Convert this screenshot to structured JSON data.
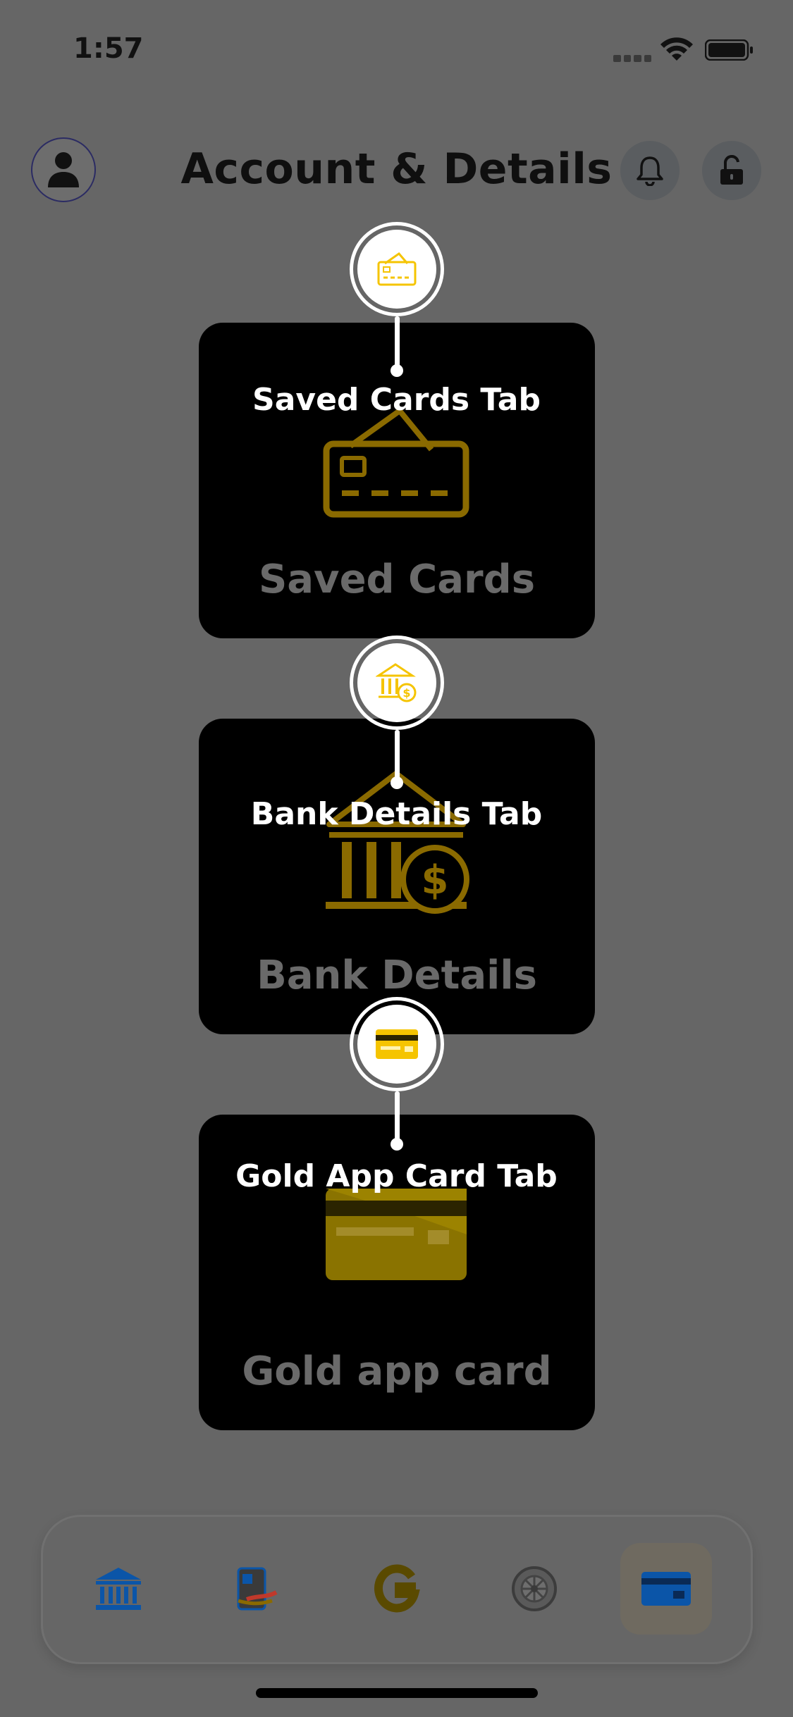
{
  "status_bar": {
    "time": "1:57"
  },
  "header": {
    "title": "Account & Details",
    "icons": [
      "user-icon",
      "bell-icon",
      "unlock-icon"
    ]
  },
  "cards": [
    {
      "label": "Saved Cards",
      "icon": "credit-card-icon"
    },
    {
      "label": "Bank Details",
      "icon": "bank-dollar-icon"
    },
    {
      "label": "Gold app card",
      "icon": "gold-card-icon"
    }
  ],
  "coachmarks": [
    {
      "text": "Saved Cards Tab"
    },
    {
      "text": "Bank Details Tab"
    },
    {
      "text": "Gold App Card Tab"
    }
  ],
  "bottom_nav": {
    "items": [
      {
        "icon": "bank-icon"
      },
      {
        "icon": "payment-phone-icon"
      },
      {
        "icon": "gold-g-icon"
      },
      {
        "icon": "vault-icon"
      },
      {
        "icon": "card-icon",
        "active": true
      }
    ]
  },
  "colors": {
    "overlay_bg": "#666666",
    "card_bg": "#000000",
    "gold": "#8a6a00",
    "bright_gold": "#f5c400",
    "nav_blue": "#0b55a8"
  }
}
